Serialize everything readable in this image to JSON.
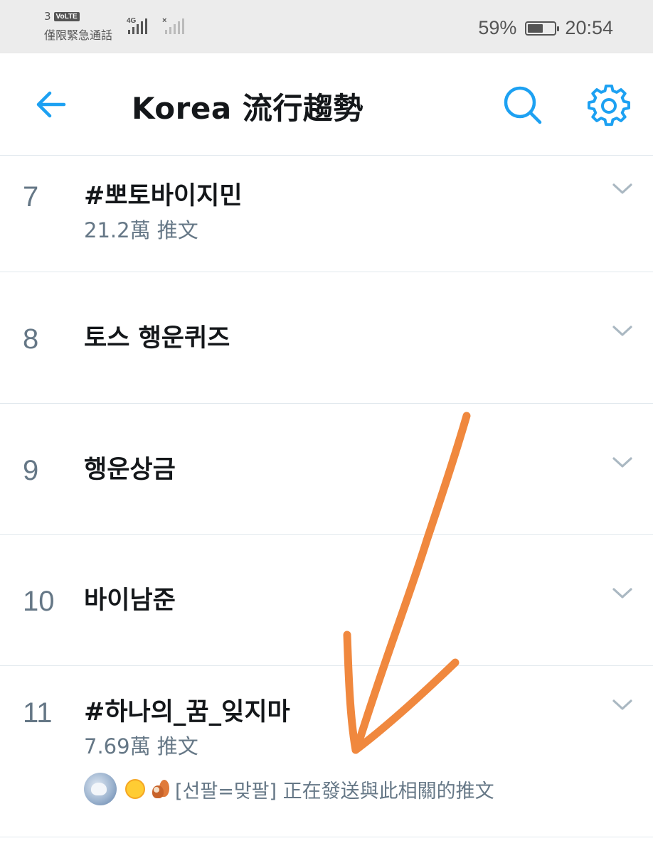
{
  "status_bar": {
    "sim_number": "3",
    "volte_badge": "VoLTE",
    "network_type": "4G",
    "emergency_text": "僅限緊急通話",
    "battery_level": "59%",
    "battery_fraction": 0.59,
    "time": "20:54"
  },
  "header": {
    "title": "Korea 流行趨勢",
    "back_icon": "arrow-left-icon",
    "search_icon": "search-icon",
    "settings_icon": "gear-icon",
    "accent_color": "#1da1f2"
  },
  "trends": [
    {
      "rank": "7",
      "name": "#뽀토바이지민",
      "count": "21.2萬 推文"
    },
    {
      "rank": "8",
      "name": "토스 행운퀴즈",
      "count": ""
    },
    {
      "rank": "9",
      "name": "행운상금",
      "count": ""
    },
    {
      "rank": "10",
      "name": "바이남준",
      "count": ""
    },
    {
      "rank": "11",
      "name": "#하나의_꿈_잊지마",
      "count": "7.69萬 推文",
      "context": "[선팔=맞팔] 正在發送與此相關的推文"
    }
  ],
  "annotation": {
    "color": "#f0883e",
    "icon": "hand-drawn-arrow"
  }
}
